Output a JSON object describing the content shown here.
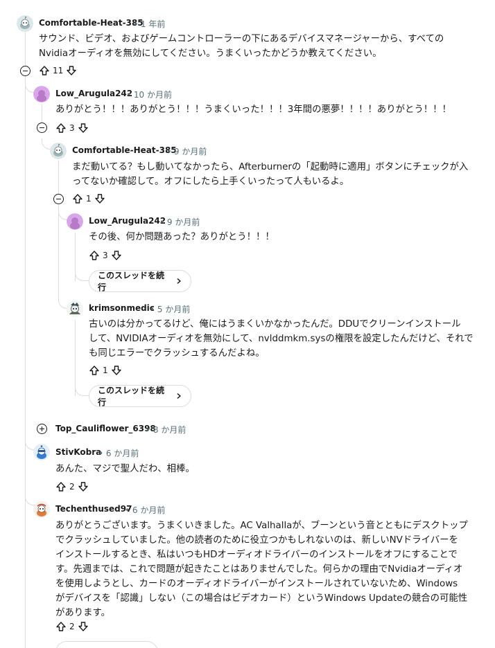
{
  "comments": {
    "c1": {
      "user": "Comfortable-Heat-385",
      "time": "• 1 年前",
      "lines": [
        "サウンド、ビデオ、およびゲームコントローラーの下にあるデバイスマネージャーから、すべての",
        "Nvidiaオーディオを無効にしてください。うまくいったかどうか教えてください。"
      ],
      "votes": "11"
    },
    "c2": {
      "user": "Low_Arugula242",
      "time": "• 10 か月前",
      "lines": [
        "ありがとう！！！ありがとう！！！うまくいった！！！3年間の悪夢！！！！ありがとう！！！"
      ],
      "votes": "3"
    },
    "c3": {
      "user": "Comfortable-Heat-385",
      "time": "• 9 か月前",
      "lines": [
        "まだ動いてる？もし動いてなかったら、Afterburnerの「起動時に適用」ボタンにチェックが入",
        "ってないか確認して。オフにしたら上手くいったって人もいるよ。"
      ],
      "votes": "1"
    },
    "c4": {
      "user": "Low_Arugula242",
      "time": "• 9 か月前",
      "lines": [
        "その後、何か問題あった？ありがとう！！！"
      ],
      "votes": "3"
    },
    "c5": {
      "user": "krimsonmedic",
      "time": "• 5 か月前",
      "lines": [
        "古いのは分かってるけど、俺にはうまくいかなかったんだ。DDUでクリーンインストール",
        "して、NVIDIAオーディオを無効にして、nvlddmkm.sysの権限を設定したんだけど、それで",
        "も同じエラーでクラッシュするんだよね。"
      ],
      "votes": "1"
    },
    "c6": {
      "user": "Top_Cauliflower_6398",
      "time": "• 8 か月前"
    },
    "c7": {
      "user": "StivKobra",
      "time": "• 6 か月前",
      "lines": [
        "あんた、マジで聖人だわ、相棒。"
      ],
      "votes": "2"
    },
    "c8": {
      "user": "Techenthused97",
      "time": "• 6 か月前",
      "lines": [
        "ありがとうございます。うまくいきました。AC Valhallaが、ブーンという音とともにデスクトップ",
        "でクラッシュしていました。他の読者のために役立つかもしれないのは、新しいNVドライバーを",
        "インストールするとき、私はいつもHDオーディオドライバーのインストールをオフにすることで",
        "す。先週までは、これで問題が起きたことはありませんでした。何らかの理由でNvidiaオーディオ",
        "を使用しようとし、カードのオーディオドライバーがインストールされていないため、Windows",
        "がデバイスを「認識」しない（この場合はビデオカード）というWindows Updateの競合の可能性",
        "があります。"
      ],
      "votes": "2"
    }
  },
  "continue_thread_label": "このスレッドを続行",
  "icons": {
    "upvote": "arrow-up-icon",
    "downvote": "arrow-down-icon",
    "collapse": "minus-circle-icon",
    "expand": "plus-circle-icon",
    "chevron": "chevron-right-icon"
  },
  "colors": {
    "text": "#1a1a1b",
    "meta": "#576f76",
    "thread_line": "#dadde0",
    "avatar_pink": "#d9a6e8"
  }
}
